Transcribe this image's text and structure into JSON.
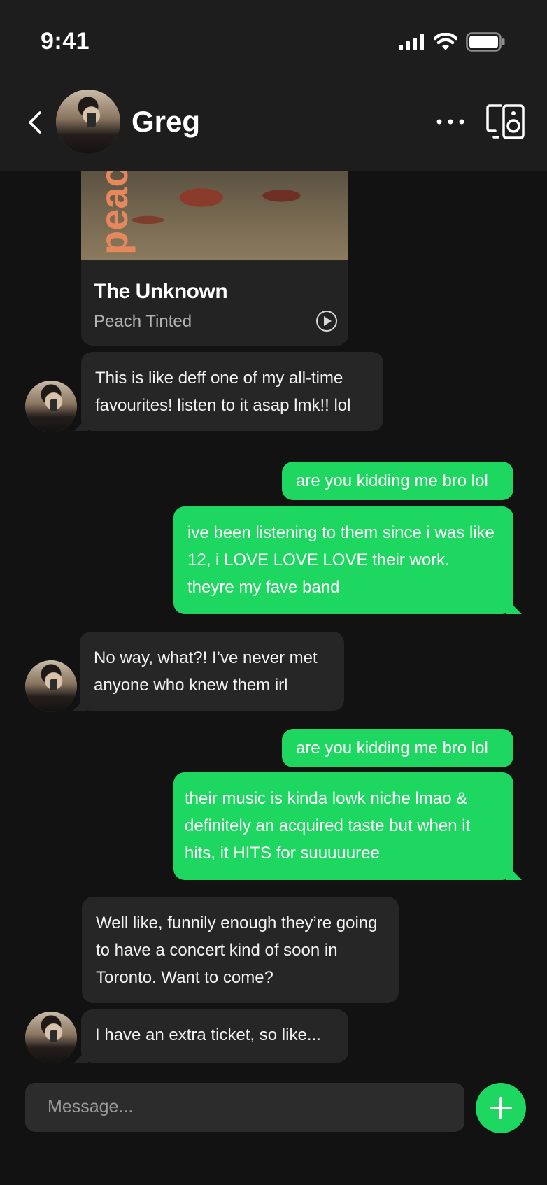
{
  "status_bar": {
    "time": "9:41"
  },
  "header": {
    "contact_name": "Greg"
  },
  "album_card": {
    "cover_text": "peac",
    "title": "The Unknown",
    "artist": "Peach Tinted"
  },
  "messages": [
    {
      "from": "contact",
      "text": "This is like deff one of my all-time favourites! listen to it asap lmk!! lol"
    },
    {
      "from": "me",
      "text": "are you kidding me bro lol"
    },
    {
      "from": "me",
      "text": "ive been listening to them since i was like 12, i LOVE LOVE LOVE their work. theyre my fave band"
    },
    {
      "from": "contact",
      "text": "No way, what?! I’ve never met anyone who knew them irl"
    },
    {
      "from": "me",
      "text": "are you kidding me bro lol"
    },
    {
      "from": "me",
      "text": "their music is kinda lowk niche lmao & definitely an acquired taste but when it hits, it HITS for suuuuuree"
    },
    {
      "from": "contact",
      "text": "Well like, funnily enough they’re going to have a concert kind of soon in Toronto. Want to come?"
    },
    {
      "from": "contact",
      "text": "I have an extra ticket, so like..."
    }
  ],
  "composer": {
    "placeholder": "Message..."
  },
  "colors": {
    "accent": "#1ed760",
    "background": "#121212",
    "incoming_bubble": "#262626",
    "header": "#1d1d1d"
  },
  "icons": [
    "back-chevron-icon",
    "more-options-icon",
    "devices-speaker-icon",
    "play-icon",
    "plus-icon",
    "signal-icon",
    "wifi-icon",
    "battery-icon"
  ]
}
